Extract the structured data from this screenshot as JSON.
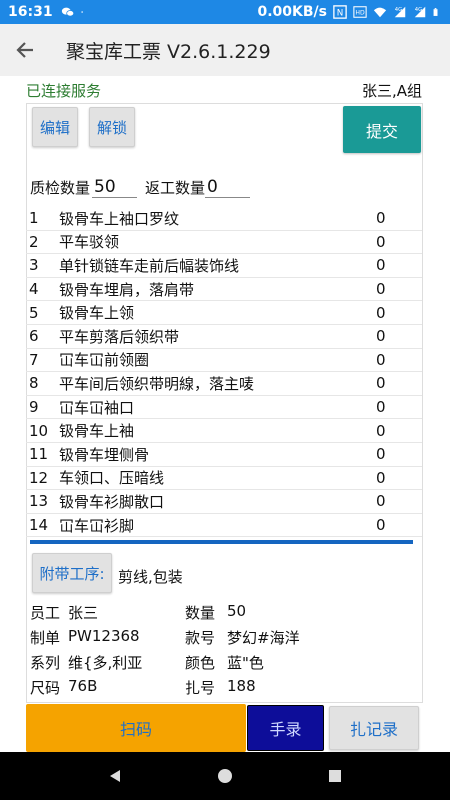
{
  "status_bar": {
    "time": "16:31",
    "left_icons": [
      "wechat-icon",
      "dot-icon"
    ],
    "speed": "0.00KB/s",
    "right_icons": [
      "n-icon",
      "hd-icon",
      "wifi-icon",
      "signal-4g-icon",
      "signal-4g-icon",
      "battery-icon"
    ]
  },
  "app_bar": {
    "back_icon": "arrow-left-icon",
    "title": "聚宝库工票 V2.6.1.229"
  },
  "connection": {
    "status": "已连接服务",
    "user_group": "张三,A组"
  },
  "toolbar": {
    "edit_label": "编辑",
    "unlock_label": "解锁",
    "submit_label": "提交"
  },
  "quantities": {
    "qc_label": "质检数量",
    "qc_value": "50",
    "rework_label": "返工数量",
    "rework_value": "0"
  },
  "processes": [
    {
      "num": "1",
      "name": "钑骨车上袖口罗纹",
      "count": "0"
    },
    {
      "num": "2",
      "name": "平车驳领",
      "count": "0"
    },
    {
      "num": "3",
      "name": "单针锁链车走前后幅装饰线",
      "count": "0"
    },
    {
      "num": "4",
      "name": "钑骨车埋肩，落肩带",
      "count": "0"
    },
    {
      "num": "5",
      "name": "钑骨车上领",
      "count": "0"
    },
    {
      "num": "6",
      "name": "平车剪落后领织带",
      "count": "0"
    },
    {
      "num": "7",
      "name": "冚车冚前领圈",
      "count": "0"
    },
    {
      "num": "8",
      "name": "平车间后领织带明線，落主唛",
      "count": "0"
    },
    {
      "num": "9",
      "name": "冚车冚袖口",
      "count": "0"
    },
    {
      "num": "10",
      "name": "钑骨车上袖",
      "count": "0"
    },
    {
      "num": "11",
      "name": "钑骨车埋侧骨",
      "count": "0"
    },
    {
      "num": "12",
      "name": "车领口、压暗线",
      "count": "0"
    },
    {
      "num": "13",
      "name": "钑骨车衫脚散口",
      "count": "0"
    },
    {
      "num": "14",
      "name": "冚车冚衫脚",
      "count": "0"
    }
  ],
  "accessory": {
    "button_label": "附带工序:",
    "value": "剪线,包装"
  },
  "info": {
    "employee_label": "员工",
    "employee_value": "张三",
    "quantity_label": "数量",
    "quantity_value": "50",
    "order_label": "制单",
    "order_value": "PW12368",
    "style_label": "款号",
    "style_value": "梦幻#海洋",
    "series_label": "系列",
    "series_value": "维{多,利亚",
    "color_label": "颜色",
    "color_value": "蓝\"色",
    "size_label": "尺码",
    "size_value": "76B",
    "bundle_label": "扎号",
    "bundle_value": "188"
  },
  "bottom_actions": {
    "scan_label": "扫码",
    "manual_label": "手录",
    "records_label": "扎记录"
  },
  "nav_bar": {
    "back_icon": "triangle-back-icon",
    "home_icon": "circle-home-icon",
    "recents_icon": "square-recents-icon"
  },
  "colors": {
    "status_bar": "#1e88e5",
    "connected_text": "#2e7d32",
    "submit_button": "#1a9a96",
    "scan_button": "#f5a300",
    "manual_button": "#0d0d99",
    "divider": "#1565c0"
  }
}
